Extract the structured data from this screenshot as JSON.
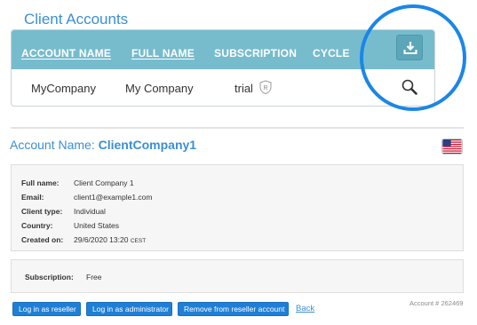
{
  "page": {
    "title": "Client Accounts"
  },
  "table": {
    "headers": [
      {
        "label": "ACCOUNT NAME",
        "sortable": true
      },
      {
        "label": "FULL NAME",
        "sortable": true
      },
      {
        "label": "SUBSCRIPTION",
        "sortable": false
      },
      {
        "label": "CYCLE",
        "sortable": false
      }
    ],
    "rows": [
      {
        "account_name": "MyCompany",
        "full_name": "My Company",
        "subscription": "trial",
        "subscription_badge": "R"
      }
    ],
    "download_icon": "download-icon",
    "search_icon": "search-icon"
  },
  "account": {
    "prefix": "Account Name:",
    "name": "ClientCompany1",
    "country_flag": "us-flag-icon",
    "details": [
      {
        "label": "Full name:",
        "value": "Client Company 1"
      },
      {
        "label": "Email:",
        "value": "client1@example1.com"
      },
      {
        "label": "Client type:",
        "value": "Individual"
      },
      {
        "label": "Country:",
        "value": "United States"
      },
      {
        "label": "Created on:",
        "value": "29/6/2020 13:20",
        "tz": "CEST"
      }
    ],
    "subscription": {
      "label": "Subscription:",
      "value": "Free"
    },
    "account_number": "Account # 262469"
  },
  "actions": {
    "login_reseller": "Log in as reseller",
    "login_admin": "Log in as administrator",
    "remove": "Remove from reseller account",
    "back": "Back"
  },
  "colors": {
    "accent": "#3a8fd6",
    "table_header": "#76bccd",
    "button": "#1f7fd6",
    "highlight_ring": "#1b86e6"
  }
}
